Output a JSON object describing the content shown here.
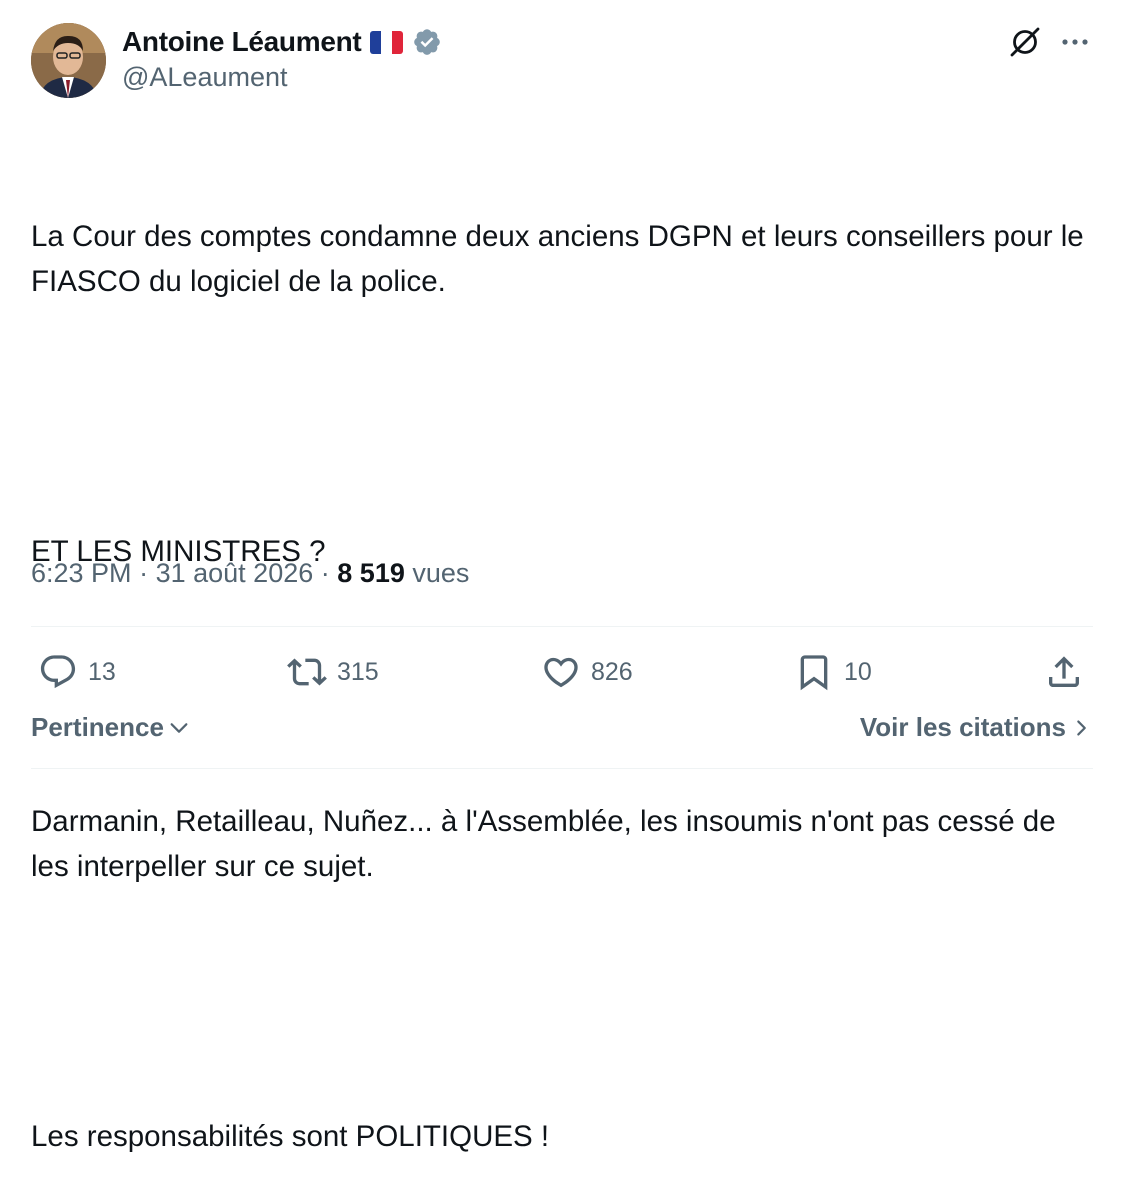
{
  "author": {
    "display_name": "Antoine Léaument",
    "handle": "@ALeaument",
    "flag": "france-flag",
    "verified_icon": "verified-badge-icon"
  },
  "tweet": {
    "paragraphs": [
      "La Cour des comptes condamne deux anciens DGPN et leurs conseillers pour le FIASCO du logiciel de la police.",
      "ET LES MINISTRES ?",
      "Darmanin, Retailleau, Nuñez... à l'Assemblée, les insoumis n'ont pas cessé de les interpeller sur ce sujet.",
      "Les responsabilités sont POLITIQUES !"
    ]
  },
  "meta": {
    "time": "6:23 PM",
    "separator": "·",
    "date": "31 août 2026",
    "views_count": "8 519",
    "views_label": "vues"
  },
  "actions": {
    "replies": "13",
    "reposts": "315",
    "likes": "826",
    "bookmarks": "10"
  },
  "footer": {
    "sort_label": "Pertinence",
    "quotes_label": "Voir les citations"
  },
  "colors": {
    "text": "#0f1419",
    "secondary": "#536471",
    "divider": "#eff3f4",
    "verified": "#829aab"
  }
}
